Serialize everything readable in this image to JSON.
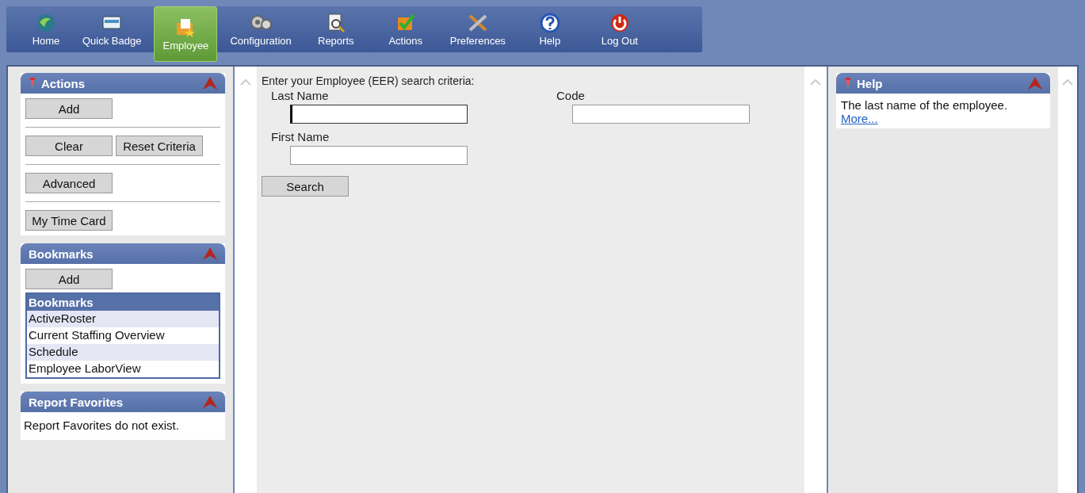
{
  "nav": [
    {
      "label": "Home",
      "selected": false
    },
    {
      "label": "Quick Badge",
      "selected": false
    },
    {
      "label": "Employee",
      "selected": true
    },
    {
      "label": "Configuration",
      "selected": false
    },
    {
      "label": "Reports",
      "selected": false
    },
    {
      "label": "Actions",
      "selected": false
    },
    {
      "label": "Preferences",
      "selected": false
    },
    {
      "label": "Help",
      "selected": false
    },
    {
      "label": "Log Out",
      "selected": false
    }
  ],
  "actions": {
    "title": "Actions",
    "pinned": true,
    "groups": [
      [
        "Add"
      ],
      [
        "Clear",
        "Reset Criteria"
      ],
      [
        "Advanced"
      ],
      [
        "My Time Card"
      ]
    ]
  },
  "bookmarks": {
    "title": "Bookmarks",
    "pinned": false,
    "button": "Add",
    "list_header": "Bookmarks",
    "items": [
      "ActiveRoster",
      "Current Staffing Overview",
      "Schedule",
      "Employee LaborView"
    ]
  },
  "report_favorites": {
    "title": "Report Favorites",
    "pinned": false,
    "message": "Report Favorites do not exist."
  },
  "search": {
    "prompt": "Enter your Employee (EER) search criteria:",
    "fields": [
      {
        "label": "Last Name",
        "focused": true
      },
      {
        "label": "Code",
        "focused": false
      },
      {
        "label": "First Name",
        "focused": false
      }
    ],
    "button": "Search"
  },
  "help": {
    "title": "Help",
    "pinned": true,
    "text": "The last name of the employee.",
    "link": "More..."
  }
}
